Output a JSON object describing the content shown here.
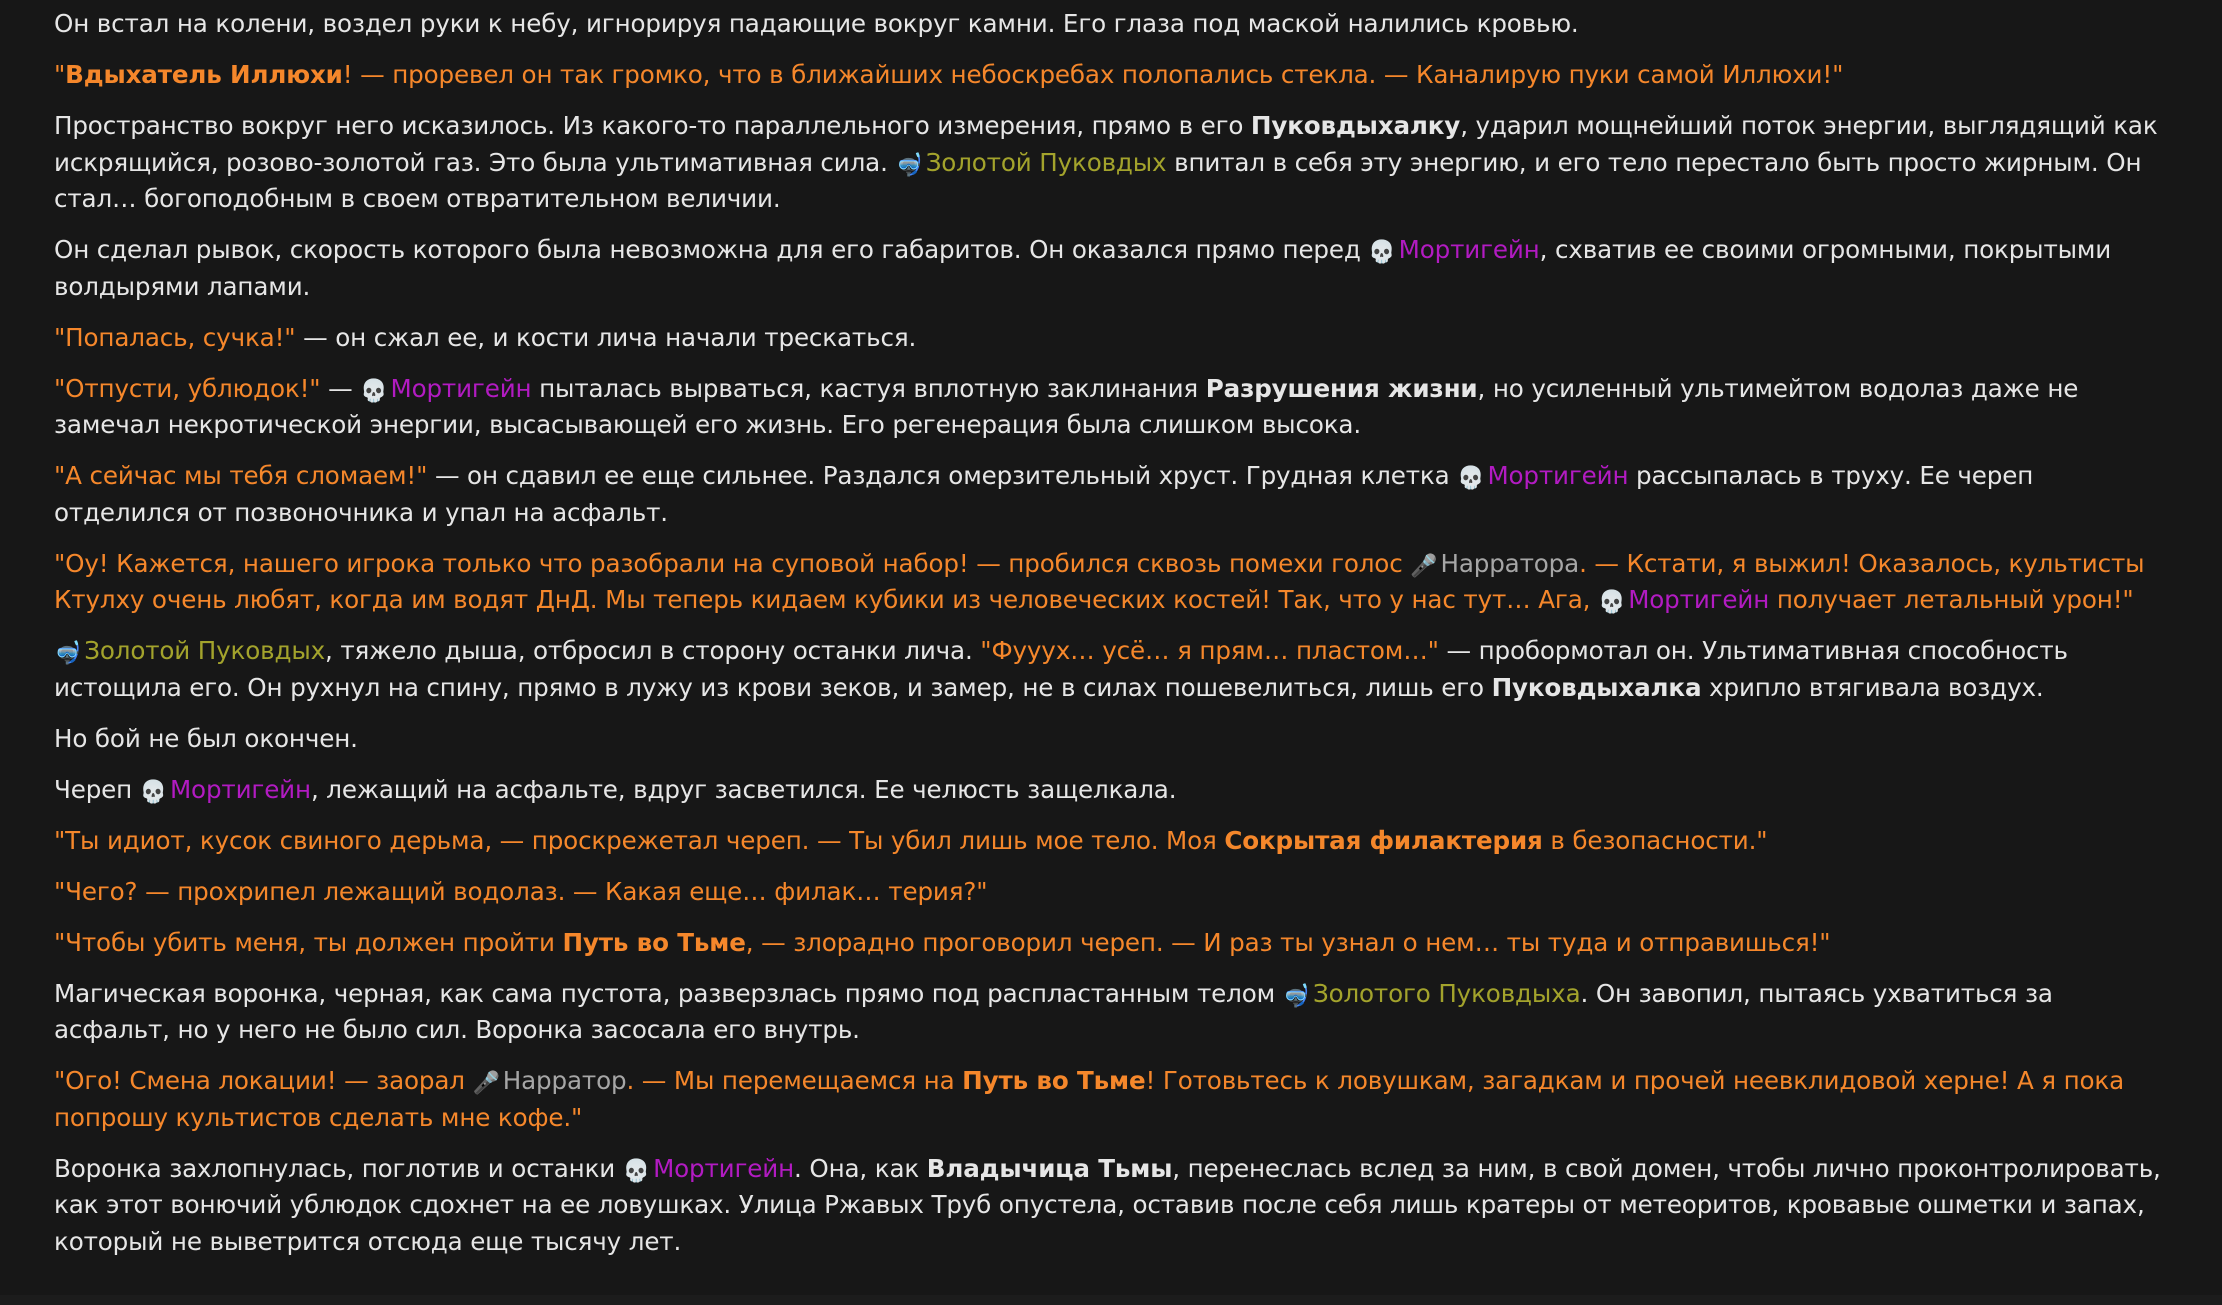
{
  "icons": {
    "skull": "💀",
    "snorkel": "🤿",
    "mic": "🎤"
  },
  "colors": {
    "background": "#171717",
    "narration_text": "#e6e6e6",
    "dialogue_text": "#f5872b",
    "golden_pukovdykh": "#a3a32c",
    "mortigein": "#b21bc2",
    "narrator": "#a6a6a6"
  },
  "paragraphs": [
    [
      {
        "s": "t",
        "v": "Он встал на колени, воздел руки к небу, игнорируя падающие вокруг камни. Его глаза под маской налились кровью."
      }
    ],
    [
      {
        "s": "q",
        "v": "\""
      },
      {
        "s": "q",
        "b": true,
        "v": "Вдыхатель Иллюхи"
      },
      {
        "s": "q",
        "v": "! — проревел он так громко, что в ближайших небоскребах полопались стекла. — Каналирую пуки самой Иллюхи!\""
      }
    ],
    [
      {
        "s": "t",
        "v": "Пространство вокруг него исказилось. Из какого-то параллельного измерения, прямо в его "
      },
      {
        "s": "t",
        "b": true,
        "v": "Пуковдыхалку"
      },
      {
        "s": "t",
        "v": ", ударил мощнейший поток энергии, выглядящий как искрящийся, розово-золотой газ. Это была ультимативная сила. "
      },
      {
        "s": "gold",
        "icon": "snorkel",
        "v": "Золотой Пуковдых"
      },
      {
        "s": "t",
        "v": " впитал в себя эту энергию, и его тело перестало быть просто жирным. Он стал… богоподобным в своем отвратительном величии."
      }
    ],
    [
      {
        "s": "t",
        "v": "Он сделал рывок, скорость которого была невозможна для его габаритов. Он оказался прямо перед "
      },
      {
        "s": "mort",
        "icon": "skull",
        "v": "Мортигейн"
      },
      {
        "s": "t",
        "v": ", схватив ее своими огромными, покрытыми волдырями лапами."
      }
    ],
    [
      {
        "s": "q",
        "v": "\"Попалась, сучка!\""
      },
      {
        "s": "t",
        "v": " — он сжал ее, и кости лича начали трескаться."
      }
    ],
    [
      {
        "s": "q",
        "v": "\"Отпусти, ублюдок!\""
      },
      {
        "s": "t",
        "v": " — "
      },
      {
        "s": "mort",
        "icon": "skull",
        "v": "Мортигейн"
      },
      {
        "s": "t",
        "v": " пыталась вырваться, кастуя вплотную заклинания "
      },
      {
        "s": "t",
        "b": true,
        "v": "Разрушения жизни"
      },
      {
        "s": "t",
        "v": ", но усиленный ультимейтом водолаз даже не замечал некротической энергии, высасывающей его жизнь. Его регенерация была слишком высока."
      }
    ],
    [
      {
        "s": "q",
        "v": "\"А сейчас мы тебя сломаем!\""
      },
      {
        "s": "t",
        "v": " — он сдавил ее еще сильнее. Раздался омерзительный хруст. Грудная клетка "
      },
      {
        "s": "mort",
        "icon": "skull",
        "v": "Мортигейн"
      },
      {
        "s": "t",
        "v": " рассыпалась в труху. Ее череп отделился от позвоночника и упал на асфальт."
      }
    ],
    [
      {
        "s": "q",
        "v": "\"Оу! Кажется, нашего игрока только что разобрали на суповой набор! — пробился сквозь помехи голос "
      },
      {
        "s": "narr",
        "icon": "mic",
        "v": "Нарратора"
      },
      {
        "s": "q",
        "v": ". — Кстати, я выжил! Оказалось, культисты Ктулху очень любят, когда им водят ДнД. Мы теперь кидаем кубики из человеческих костей! Так, что у нас тут… Ага, "
      },
      {
        "s": "mort",
        "icon": "skull",
        "v": "Мортигейн"
      },
      {
        "s": "q",
        "v": " получает летальный урон!\""
      }
    ],
    [
      {
        "s": "gold",
        "icon": "snorkel",
        "v": "Золотой Пуковдых"
      },
      {
        "s": "t",
        "v": ", тяжело дыша, отбросил в сторону останки лича. "
      },
      {
        "s": "q",
        "v": "\"Фууух… усё… я прям… пластом…\""
      },
      {
        "s": "t",
        "v": " — пробормотал он. Ультимативная способность истощила его. Он рухнул на спину, прямо в лужу из крови зеков, и замер, не в силах пошевелиться, лишь его "
      },
      {
        "s": "t",
        "b": true,
        "v": "Пуковдыхалка"
      },
      {
        "s": "t",
        "v": " хрипло втягивала воздух."
      }
    ],
    [
      {
        "s": "t",
        "v": "Но бой не был окончен."
      }
    ],
    [
      {
        "s": "t",
        "v": "Череп "
      },
      {
        "s": "mort",
        "icon": "skull",
        "v": "Мортигейн"
      },
      {
        "s": "t",
        "v": ", лежащий на асфальте, вдруг засветился. Ее челюсть защелкала."
      }
    ],
    [
      {
        "s": "q",
        "v": "\"Ты идиот, кусок свиного дерьма, — проскрежетал череп. — Ты убил лишь мое тело. Моя "
      },
      {
        "s": "q",
        "b": true,
        "v": "Сокрытая филактерия"
      },
      {
        "s": "q",
        "v": " в безопасности.\""
      }
    ],
    [
      {
        "s": "q",
        "v": "\"Чего? — прохрипел лежащий водолаз. — Какая еще… филак… терия?\""
      }
    ],
    [
      {
        "s": "q",
        "v": "\"Чтобы убить меня, ты должен пройти "
      },
      {
        "s": "q",
        "b": true,
        "v": "Путь во Тьме"
      },
      {
        "s": "q",
        "v": ", — злорадно проговорил череп. — И раз ты узнал о нем… ты туда и отправишься!\""
      }
    ],
    [
      {
        "s": "t",
        "v": "Магическая воронка, черная, как сама пустота, разверзлась прямо под распластанным телом "
      },
      {
        "s": "gold",
        "icon": "snorkel",
        "v": "Золотого Пуковдыха"
      },
      {
        "s": "t",
        "v": ". Он завопил, пытаясь ухватиться за асфальт, но у него не было сил. Воронка засосала его внутрь."
      }
    ],
    [
      {
        "s": "q",
        "v": "\"Ого! Смена локации! — заорал "
      },
      {
        "s": "narr",
        "icon": "mic",
        "v": "Нарратор"
      },
      {
        "s": "q",
        "v": ". — Мы перемещаемся на "
      },
      {
        "s": "q",
        "b": true,
        "v": "Путь во Тьме"
      },
      {
        "s": "q",
        "v": "! Готовьтесь к ловушкам, загадкам и прочей неевклидовой херне! А я пока попрошу культистов сделать мне кофе.\""
      }
    ],
    [
      {
        "s": "t",
        "v": "Воронка захлопнулась, поглотив и останки "
      },
      {
        "s": "mort",
        "icon": "skull",
        "v": "Мортигейн"
      },
      {
        "s": "t",
        "v": ". Она, как "
      },
      {
        "s": "t",
        "b": true,
        "v": "Владычица Тьмы"
      },
      {
        "s": "t",
        "v": ", перенеслась вслед за ним, в свой домен, чтобы лично проконтролировать, как этот вонючий ублюдок сдохнет на ее ловушках. Улица Ржавых Труб опустела, оставив после себя лишь кратеры от метеоритов, кровавые ошметки и запах, который не выветрится отсюда еще тысячу лет."
      }
    ]
  ]
}
